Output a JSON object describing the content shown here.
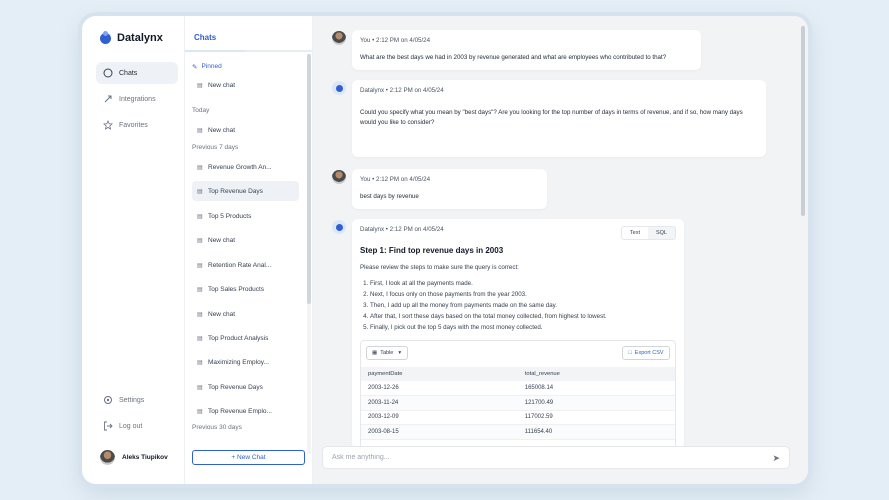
{
  "app": {
    "name": "Datalynx"
  },
  "nav": {
    "items": [
      {
        "label": "Chats",
        "icon": "chat-bubble-icon"
      },
      {
        "label": "Integrations",
        "icon": "plug-icon"
      },
      {
        "label": "Favorites",
        "icon": "star-icon"
      }
    ],
    "settings_label": "Settings",
    "logout_label": "Log out",
    "user_name": "Aleks Tiupikov"
  },
  "chats": {
    "title": "Chats",
    "pinned_label": "Pinned",
    "pinned": [
      "New chat"
    ],
    "today_label": "Today",
    "today": [
      "New chat"
    ],
    "previous7_label": "Previous 7 days",
    "previous7": [
      "Revenue Growth An...",
      "Top Revenue Days",
      "Top 5 Products",
      "New chat",
      "Retention Rate Anal...",
      "Top Sales Products",
      "New chat",
      "Top Product Analysis",
      "Maximizing Employ...",
      "Top Revenue Days",
      "Top Revenue Emplo..."
    ],
    "previous30_label": "Previous 30 days",
    "new_chat_label": "+ New Chat"
  },
  "messages": [
    {
      "author": "You",
      "meta": "You • 2:12 PM on 4/05/24",
      "text": "What are the best days we had in 2003 by revenue generated and what are employees who contributed to that?"
    },
    {
      "author": "Datalynx",
      "meta": "Datalynx • 2:12 PM on 4/05/24",
      "text": "Could you specify what you mean by \"best days\"? Are you looking for the top number of days in terms of revenue, and if so, how many days would you like to consider?"
    },
    {
      "author": "You",
      "meta": "You • 2:12 PM on 4/05/24",
      "text": "best days by revenue"
    },
    {
      "author": "Datalynx",
      "meta": "Datalynx • 2:12 PM on 4/05/24",
      "toggle": [
        "Text",
        "SQL"
      ],
      "step_title": "Step 1: Find top revenue days in 2003",
      "step_sub": "Please review the steps to make sure the query is correct:",
      "steps": [
        "First, I look at all the payments made.",
        "Next, I focus only on those payments from the year 2003.",
        "Then, I add up all the money from payments made on the same day.",
        "After that, I sort these days based on the total money collected, from highest to lowest.",
        "Finally, I pick out the top 5 days with the most money collected."
      ],
      "table": {
        "view_label": "Table",
        "export_label": "Export CSV",
        "columns": [
          "paymentDate",
          "total_revenue"
        ],
        "rows": [
          [
            "2003-12-26",
            "165008.14"
          ],
          [
            "2003-11-24",
            "121700.49"
          ],
          [
            "2003-12-09",
            "117002.59"
          ],
          [
            "2003-08-15",
            "111654.40"
          ]
        ]
      }
    }
  ],
  "composer": {
    "placeholder": "Ask me anything..."
  }
}
